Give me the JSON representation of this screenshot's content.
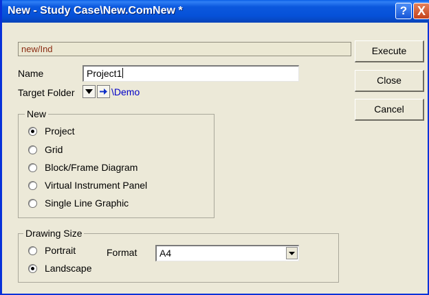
{
  "window": {
    "title": "New - Study Case\\New.ComNew *",
    "help_label": "?",
    "close_label": "X"
  },
  "path_value": "new/Ind",
  "name_field": {
    "label": "Name",
    "value": "Project1"
  },
  "target_folder": {
    "label": "Target Folder",
    "value": "\\Demo"
  },
  "new_group": {
    "title": "New",
    "options": [
      {
        "label": "Project",
        "selected": true
      },
      {
        "label": "Grid",
        "selected": false
      },
      {
        "label": "Block/Frame Diagram",
        "selected": false
      },
      {
        "label": "Virtual Instrument Panel",
        "selected": false
      },
      {
        "label": "Single Line Graphic",
        "selected": false
      }
    ]
  },
  "drawing_size": {
    "title": "Drawing Size",
    "options": [
      {
        "label": "Portrait",
        "selected": false
      },
      {
        "label": "Landscape",
        "selected": true
      }
    ],
    "format_label": "Format",
    "format_value": "A4"
  },
  "buttons": {
    "execute": "Execute",
    "close": "Close",
    "cancel": "Cancel"
  },
  "colors": {
    "titlebar": "#0651d8",
    "dialog_bg": "#ece9d8",
    "folder_link": "#0000c8",
    "path_text": "#8a2b12"
  }
}
